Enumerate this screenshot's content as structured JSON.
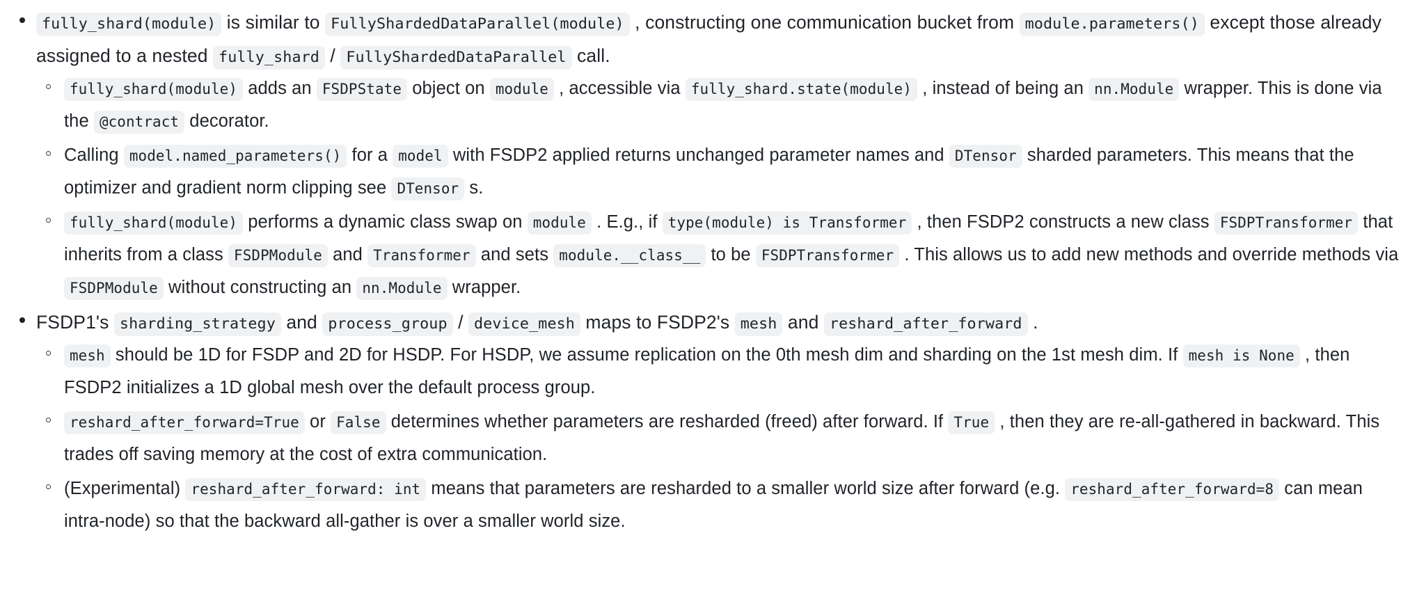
{
  "document": {
    "type": "markdown-notes",
    "theme": {
      "background": "#ffffff",
      "text_color": "#1f2328",
      "code_background": "#eff1f3",
      "code_text_color": "#1f2328"
    },
    "bullets": {
      "top_marker": "disc",
      "sub_marker": "circle"
    }
  },
  "content": {
    "items": [
      {
        "id": "fully-shard-overview",
        "marker": "disc",
        "runs": [
          {
            "t": "code",
            "v": "fully_shard(module)"
          },
          {
            "t": "text",
            "v": " is similar to "
          },
          {
            "t": "code",
            "v": "FullyShardedDataParallel(module)"
          },
          {
            "t": "text",
            "v": " , constructing one communication bucket from "
          },
          {
            "t": "code",
            "v": "module.parameters()"
          },
          {
            "t": "text",
            "v": " except those already assigned to a nested "
          },
          {
            "t": "code",
            "v": "fully_shard"
          },
          {
            "t": "text",
            "v": " / "
          },
          {
            "t": "code",
            "v": "FullyShardedDataParallel"
          },
          {
            "t": "text",
            "v": " call."
          }
        ],
        "children": [
          {
            "id": "fsdp-state-object",
            "marker": "circle",
            "runs": [
              {
                "t": "code",
                "v": "fully_shard(module)"
              },
              {
                "t": "text",
                "v": " adds an "
              },
              {
                "t": "code",
                "v": "FSDPState"
              },
              {
                "t": "text",
                "v": " object on "
              },
              {
                "t": "code",
                "v": "module"
              },
              {
                "t": "text",
                "v": " , accessible via "
              },
              {
                "t": "code",
                "v": "fully_shard.state(module)"
              },
              {
                "t": "text",
                "v": " , instead of being an "
              },
              {
                "t": "code",
                "v": "nn.Module"
              },
              {
                "t": "text",
                "v": " wrapper. This is done via the "
              },
              {
                "t": "code",
                "v": "@contract"
              },
              {
                "t": "text",
                "v": " decorator."
              }
            ]
          },
          {
            "id": "named-parameters-dtensor",
            "marker": "circle",
            "runs": [
              {
                "t": "text",
                "v": "Calling "
              },
              {
                "t": "code",
                "v": "model.named_parameters()"
              },
              {
                "t": "text",
                "v": " for a "
              },
              {
                "t": "code",
                "v": "model"
              },
              {
                "t": "text",
                "v": " with FSDP2 applied returns unchanged parameter names and "
              },
              {
                "t": "code",
                "v": "DTensor"
              },
              {
                "t": "text",
                "v": " sharded parameters. This means that the optimizer and gradient norm clipping see "
              },
              {
                "t": "code",
                "v": "DTensor"
              },
              {
                "t": "text",
                "v": " s."
              }
            ]
          },
          {
            "id": "dynamic-class-swap",
            "marker": "circle",
            "runs": [
              {
                "t": "code",
                "v": "fully_shard(module)"
              },
              {
                "t": "text",
                "v": " performs a dynamic class swap on "
              },
              {
                "t": "code",
                "v": "module"
              },
              {
                "t": "text",
                "v": " . E.g., if "
              },
              {
                "t": "code",
                "v": "type(module) is Transformer"
              },
              {
                "t": "text",
                "v": " , then FSDP2 constructs a new class "
              },
              {
                "t": "code",
                "v": "FSDPTransformer"
              },
              {
                "t": "text",
                "v": " that inherits from a class "
              },
              {
                "t": "code",
                "v": "FSDPModule"
              },
              {
                "t": "text",
                "v": " and "
              },
              {
                "t": "code",
                "v": "Transformer"
              },
              {
                "t": "text",
                "v": " and sets "
              },
              {
                "t": "code",
                "v": "module.__class__"
              },
              {
                "t": "text",
                "v": " to be "
              },
              {
                "t": "code",
                "v": "FSDPTransformer"
              },
              {
                "t": "text",
                "v": " . This allows us to add new methods and override methods via "
              },
              {
                "t": "code",
                "v": "FSDPModule"
              },
              {
                "t": "text",
                "v": " without constructing an "
              },
              {
                "t": "code",
                "v": "nn.Module"
              },
              {
                "t": "text",
                "v": " wrapper."
              }
            ]
          }
        ]
      },
      {
        "id": "fsdp1-to-fsdp2-mapping",
        "marker": "disc",
        "runs": [
          {
            "t": "text",
            "v": "FSDP1's "
          },
          {
            "t": "code",
            "v": "sharding_strategy"
          },
          {
            "t": "text",
            "v": " and "
          },
          {
            "t": "code",
            "v": "process_group"
          },
          {
            "t": "text",
            "v": " / "
          },
          {
            "t": "code",
            "v": "device_mesh"
          },
          {
            "t": "text",
            "v": " maps to FSDP2's "
          },
          {
            "t": "code",
            "v": "mesh"
          },
          {
            "t": "text",
            "v": " and "
          },
          {
            "t": "code",
            "v": "reshard_after_forward"
          },
          {
            "t": "text",
            "v": " ."
          }
        ],
        "children": [
          {
            "id": "mesh-dimensions",
            "marker": "circle",
            "runs": [
              {
                "t": "code",
                "v": "mesh"
              },
              {
                "t": "text",
                "v": " should be 1D for FSDP and 2D for HSDP. For HSDP, we assume replication on the 0th mesh dim and sharding on the 1st mesh dim. If "
              },
              {
                "t": "code",
                "v": "mesh is None"
              },
              {
                "t": "text",
                "v": " , then FSDP2 initializes a 1D global mesh over the default process group."
              }
            ]
          },
          {
            "id": "reshard-after-forward-bool",
            "marker": "circle",
            "runs": [
              {
                "t": "code",
                "v": "reshard_after_forward=True"
              },
              {
                "t": "text",
                "v": " or "
              },
              {
                "t": "code",
                "v": "False"
              },
              {
                "t": "text",
                "v": " determines whether parameters are resharded (freed) after forward. If "
              },
              {
                "t": "code",
                "v": "True"
              },
              {
                "t": "text",
                "v": " , then they are re-all-gathered in backward. This trades off saving memory at the cost of extra communication."
              }
            ]
          },
          {
            "id": "reshard-after-forward-int",
            "marker": "circle",
            "runs": [
              {
                "t": "text",
                "v": "(Experimental) "
              },
              {
                "t": "code",
                "v": "reshard_after_forward: int"
              },
              {
                "t": "text",
                "v": " means that parameters are resharded to a smaller world size after forward (e.g. "
              },
              {
                "t": "code",
                "v": "reshard_after_forward=8"
              },
              {
                "t": "text",
                "v": " can mean intra-node) so that the backward all-gather is over a smaller world size."
              }
            ]
          }
        ]
      }
    ]
  }
}
